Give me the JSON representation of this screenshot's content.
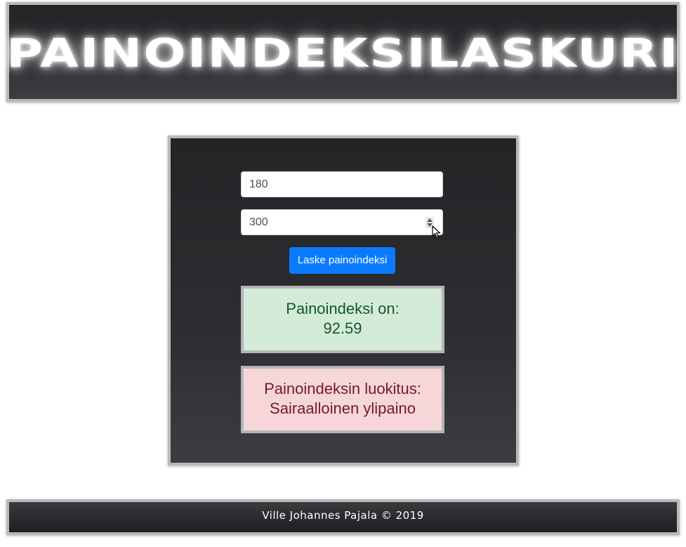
{
  "header": {
    "title": "PAINOINDEKSILASKURI"
  },
  "form": {
    "height_value": "180",
    "weight_value": "300",
    "calculate_label": "Laske painoindeksi"
  },
  "results": {
    "bmi_label": "Painoindeksi on:",
    "bmi_value": "92.59",
    "class_label": "Painoindeksin luokitus:",
    "class_value": "Sairaalloinen ylipaino"
  },
  "footer": {
    "text": "Ville Johannes Pajala © 2019"
  },
  "colors": {
    "accent": "#0a7bff",
    "success_bg": "#d4ebda",
    "success_text": "#155724",
    "danger_bg": "#f7d6d9",
    "danger_text": "#721c24"
  },
  "icons": {
    "spinner": "number-spinner-icon",
    "cursor": "mouse-cursor-icon"
  }
}
